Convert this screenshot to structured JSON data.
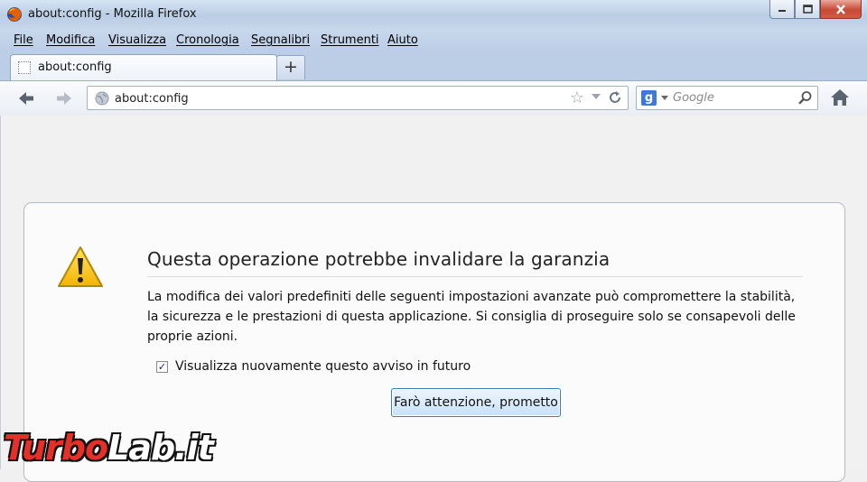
{
  "window": {
    "title": "about:config - Mozilla Firefox"
  },
  "menu": {
    "items": [
      "File",
      "Modifica",
      "Visualizza",
      "Cronologia",
      "Segnalibri",
      "Strumenti",
      "Aiuto"
    ]
  },
  "tabs": [
    {
      "label": "about:config"
    }
  ],
  "newtab_label": "+",
  "toolbar": {
    "url": "about:config",
    "search_placeholder": "Google"
  },
  "warning": {
    "heading": "Questa operazione potrebbe invalidare la garanzia",
    "description": "La modifica dei valori predefiniti delle seguenti impostazioni avanzate può compromettere la stabilità, la sicurezza e le prestazioni di questa applicazione. Si consiglia di proseguire solo se consapevoli delle proprie azioni.",
    "checkbox_label": "Visualizza nuovamente questo avviso in futuro",
    "checkbox_checked": true,
    "button_label": "Farò attenzione, prometto"
  },
  "watermark": {
    "part1": "Turbo",
    "part2": "Lab.it"
  },
  "colors": {
    "accent": "#3c7fb1",
    "warning_yellow": "#f5c518",
    "watermark_red": "#e5302a"
  }
}
